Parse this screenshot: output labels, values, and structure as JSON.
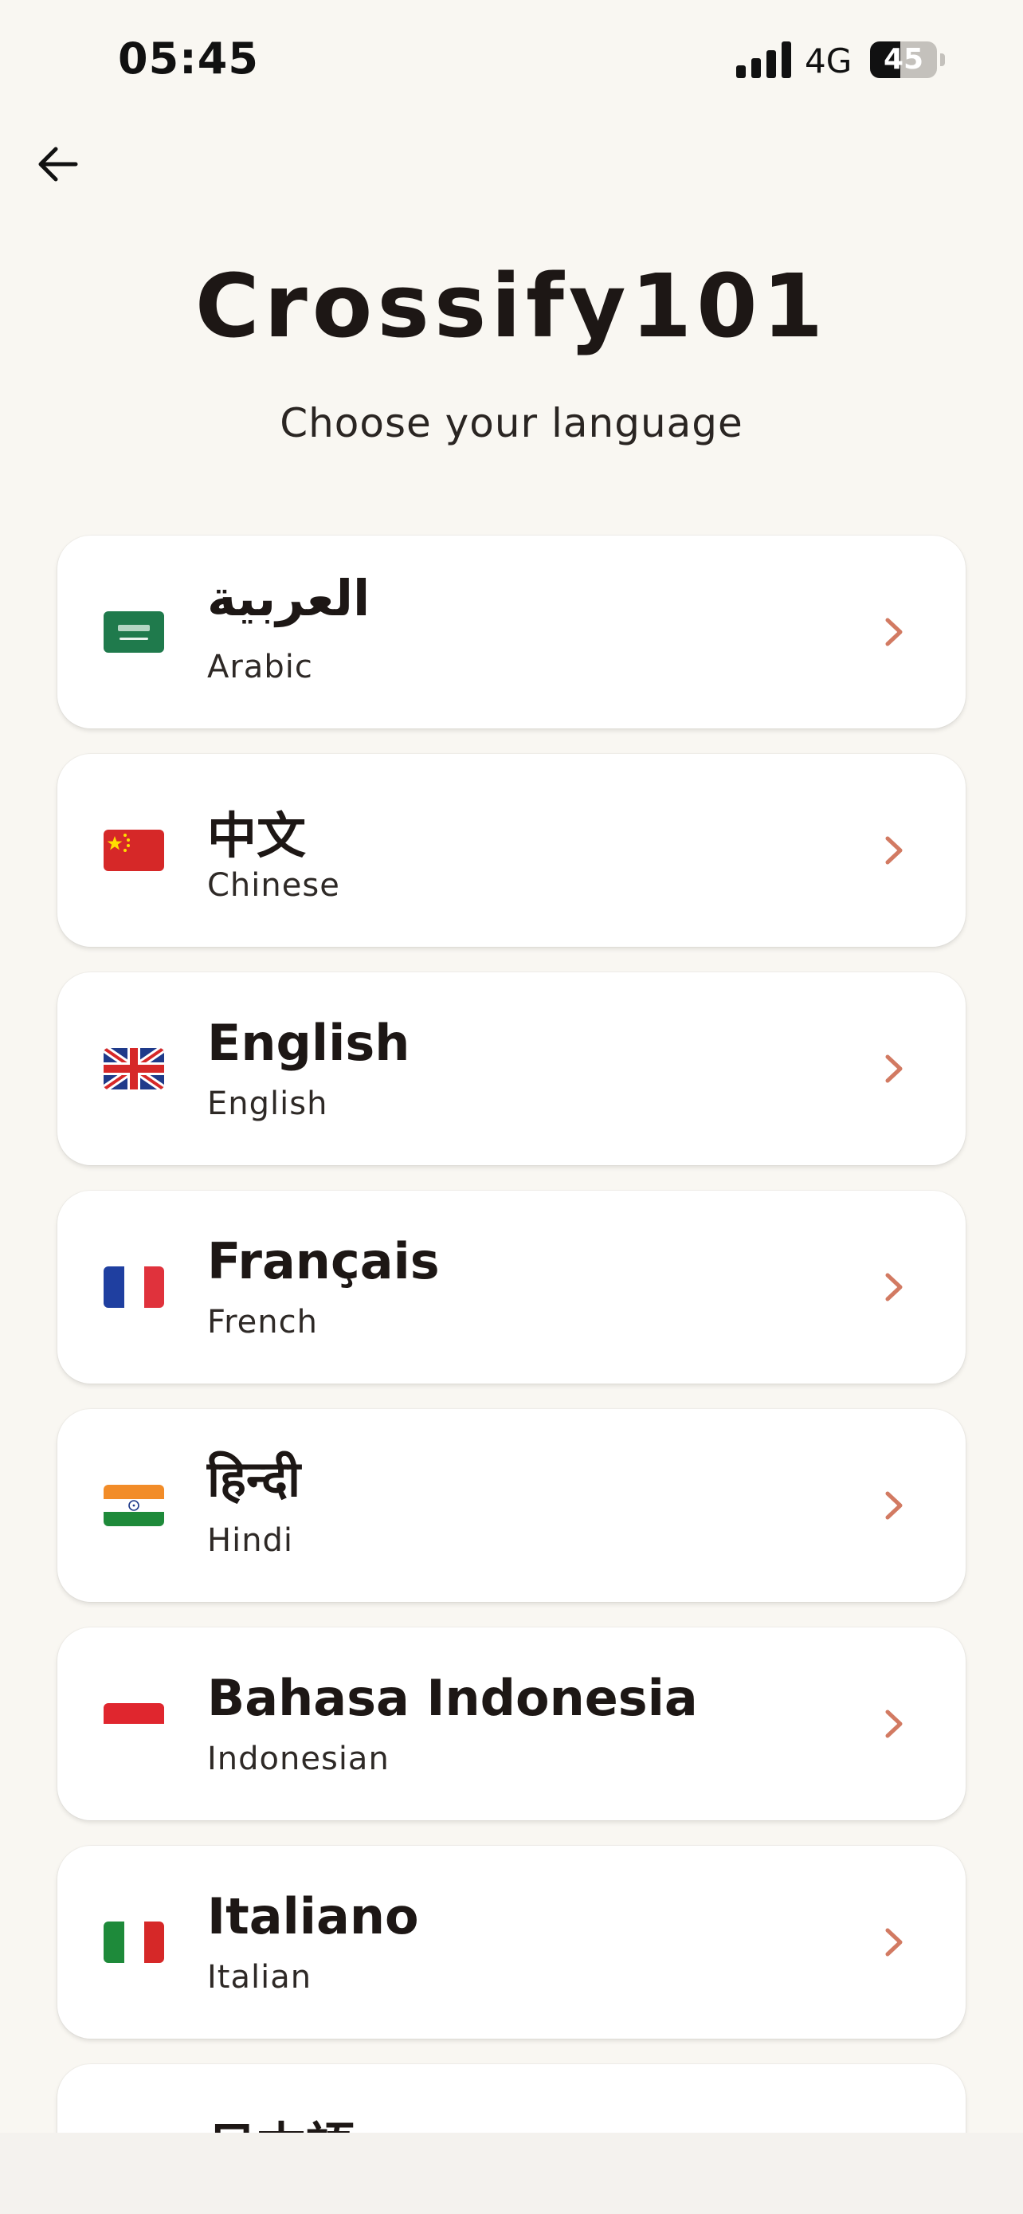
{
  "status_bar": {
    "time": "05:45",
    "network": "4G",
    "battery": "45",
    "battery_level": 0.45
  },
  "header": {
    "title": "Crossify101",
    "subtitle": "Choose your language"
  },
  "languages": [
    {
      "native": "العربية",
      "english": "Arabic",
      "flag": "saudi-arabia-flag"
    },
    {
      "native": "中文",
      "english": "Chinese",
      "flag": "china-flag"
    },
    {
      "native": "English",
      "english": "English",
      "flag": "united-kingdom-flag"
    },
    {
      "native": "Français",
      "english": "French",
      "flag": "france-flag"
    },
    {
      "native": "हिन्दी",
      "english": "Hindi",
      "flag": "india-flag"
    },
    {
      "native": "Bahasa Indonesia",
      "english": "Indonesian",
      "flag": "indonesia-flag"
    },
    {
      "native": "Italiano",
      "english": "Italian",
      "flag": "italy-flag"
    },
    {
      "native": "日本語",
      "english": "",
      "flag": "japan-flag"
    }
  ],
  "colors": {
    "background": "#F9F7F2",
    "card": "#FFFFFF",
    "chevron": "#D27A62",
    "text": "#1D1715"
  }
}
